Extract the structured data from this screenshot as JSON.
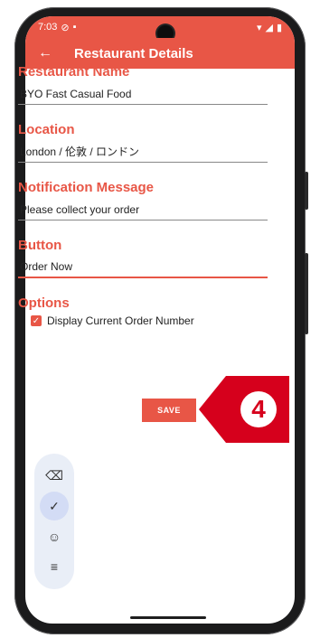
{
  "status_bar": {
    "time": "7:03",
    "left_icons": [
      "location-icon",
      "photo-icon"
    ],
    "right_icons": [
      "wifi-icon",
      "signal-icon",
      "battery-icon"
    ]
  },
  "app_bar": {
    "title": "Restaurant Details",
    "back_icon": "arrow-left-icon"
  },
  "fields": [
    {
      "label": "Restaurant Name",
      "value": "BYO Fast Casual Food"
    },
    {
      "label": "Location",
      "value": "London / 伦敦 / ロンドン"
    },
    {
      "label": "Notification Message",
      "value": "Please collect your order"
    },
    {
      "label": "Button",
      "value": "Order Now"
    }
  ],
  "options": {
    "label": "Options",
    "checkbox_label": "Display Current Order Number",
    "checked": true
  },
  "save_label": "SAVE",
  "callout": {
    "number": "4",
    "color": "#d6001c"
  },
  "keyboard_toolbar": {
    "items": [
      "backspace-icon",
      "check-icon",
      "emoji-icon",
      "menu-icon"
    ]
  },
  "colors": {
    "accent": "#e85646"
  }
}
